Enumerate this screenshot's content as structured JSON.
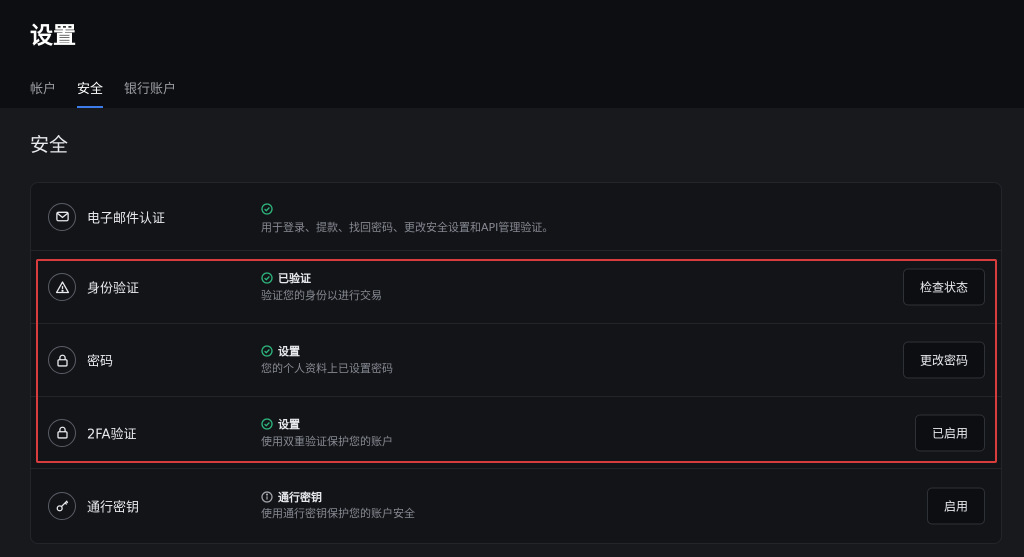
{
  "header": {
    "title": "设置",
    "tabs": [
      {
        "label": "帐户",
        "active": false
      },
      {
        "label": "安全",
        "active": true
      },
      {
        "label": "银行账户",
        "active": false
      }
    ]
  },
  "section": {
    "title": "安全"
  },
  "rows": [
    {
      "label": "电子邮件认证",
      "icon": "mail-icon",
      "status_icon": "check-circle-icon",
      "status": "",
      "description": "用于登录、提款、找回密码、更改安全设置和API管理验证。",
      "button": ""
    },
    {
      "label": "身份验证",
      "icon": "warning-icon",
      "status_icon": "check-circle-icon",
      "status": "已验证",
      "description": "验证您的身份以进行交易",
      "button": "检查状态"
    },
    {
      "label": "密码",
      "icon": "lock-icon",
      "status_icon": "check-circle-icon",
      "status": "设置",
      "description": "您的个人资料上已设置密码",
      "button": "更改密码"
    },
    {
      "label": "2FA验证",
      "icon": "lock-icon",
      "status_icon": "check-circle-icon",
      "status": "设置",
      "description": "使用双重验证保护您的账户",
      "button": "已启用"
    },
    {
      "label": "通行密钥",
      "icon": "key-icon",
      "status_icon": "info-circle-icon",
      "status": "通行密钥",
      "description": "使用通行密钥保护您的账户安全",
      "button": "启用"
    }
  ],
  "colors": {
    "background": "#18191d",
    "header_background": "#0d0e11",
    "card_background": "#131418",
    "accent": "#3d7ce8",
    "success": "#2eb67d",
    "highlight_border": "#d93c3c"
  }
}
